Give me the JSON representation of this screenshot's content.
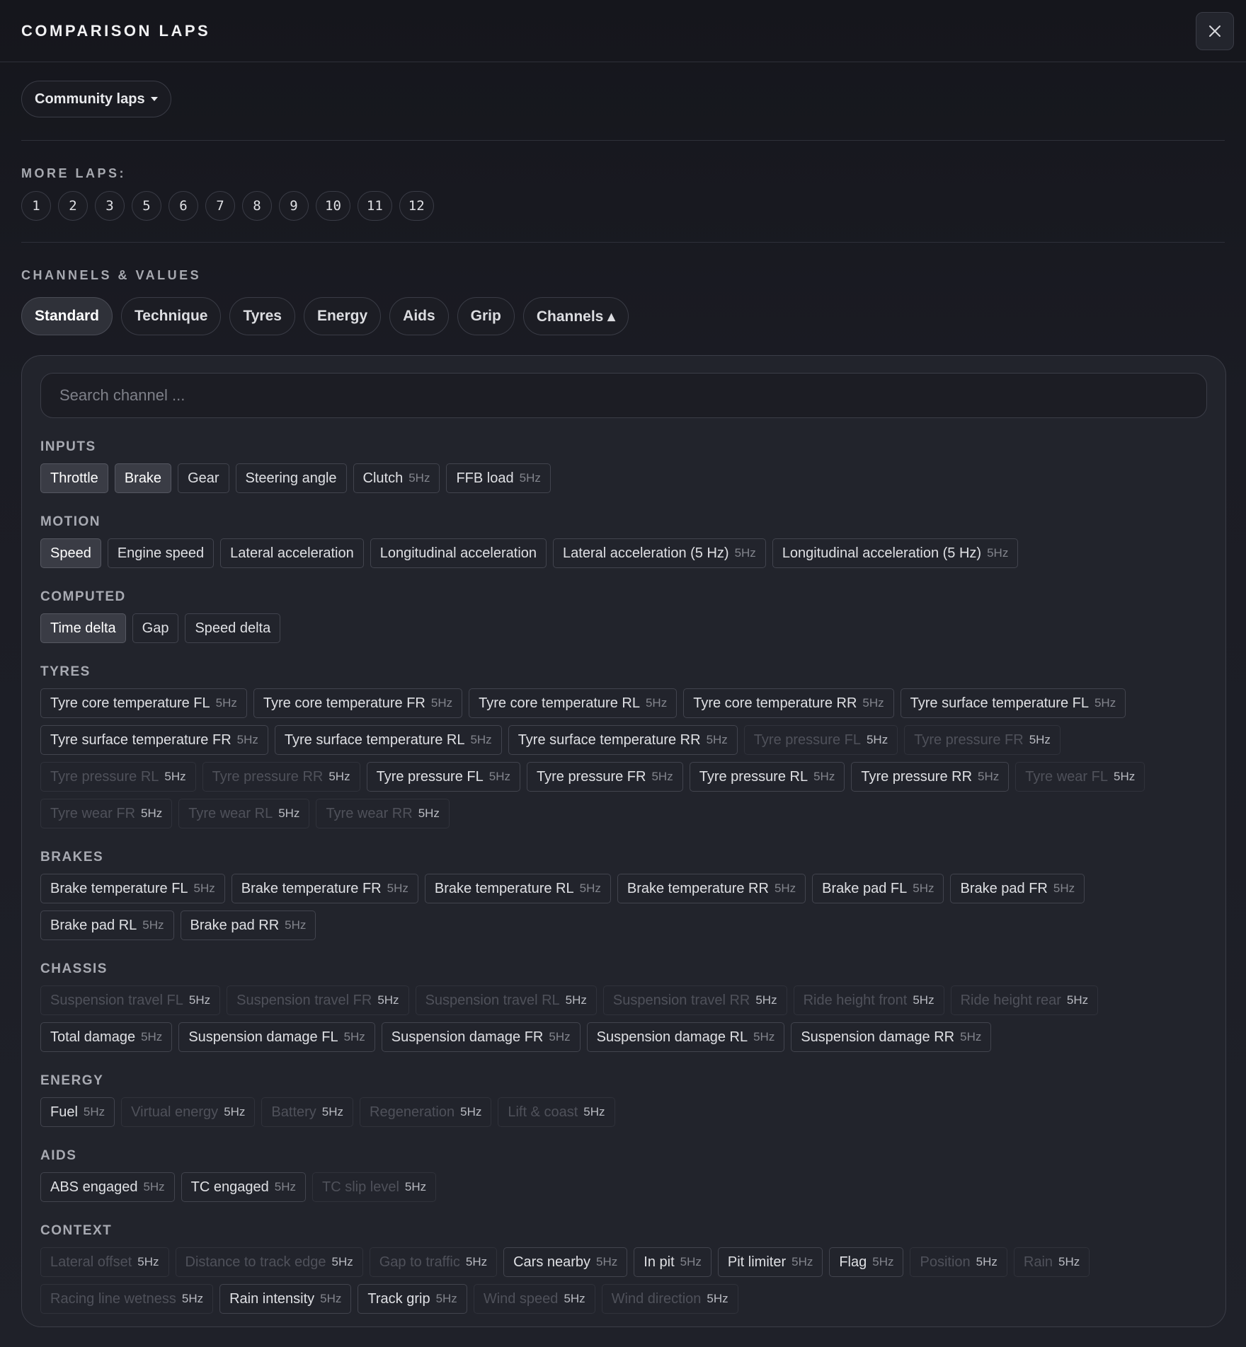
{
  "header": {
    "title": "COMPARISON LAPS",
    "close_label": "✕"
  },
  "source_dropdown": {
    "label": "Community laps"
  },
  "more_laps": {
    "title": "MORE LAPS:",
    "laps": [
      "1",
      "2",
      "3",
      "5",
      "6",
      "7",
      "8",
      "9",
      "10",
      "11",
      "12"
    ]
  },
  "channels": {
    "title": "CHANNELS & VALUES",
    "tabs": [
      {
        "label": "Standard",
        "active": true
      },
      {
        "label": "Technique",
        "active": false
      },
      {
        "label": "Tyres",
        "active": false
      },
      {
        "label": "Energy",
        "active": false
      },
      {
        "label": "Aids",
        "active": false
      },
      {
        "label": "Grip",
        "active": false
      },
      {
        "label": "Channels ▴",
        "active": false
      }
    ],
    "search_placeholder": "Search channel ...",
    "groups": [
      {
        "title": "INPUTS",
        "chips": [
          {
            "label": "Throttle",
            "state": "sel"
          },
          {
            "label": "Brake",
            "state": "sel"
          },
          {
            "label": "Gear"
          },
          {
            "label": "Steering angle"
          },
          {
            "label": "Clutch",
            "hz": "5Hz"
          },
          {
            "label": "FFB load",
            "hz": "5Hz"
          }
        ]
      },
      {
        "title": "MOTION",
        "chips": [
          {
            "label": "Speed",
            "state": "sel"
          },
          {
            "label": "Engine speed"
          },
          {
            "label": "Lateral acceleration"
          },
          {
            "label": "Longitudinal acceleration"
          },
          {
            "label": "Lateral acceleration (5 Hz)",
            "hz": "5Hz"
          },
          {
            "label": "Longitudinal acceleration (5 Hz)",
            "hz": "5Hz"
          }
        ]
      },
      {
        "title": "COMPUTED",
        "chips": [
          {
            "label": "Time delta",
            "state": "sel"
          },
          {
            "label": "Gap"
          },
          {
            "label": "Speed delta"
          }
        ]
      },
      {
        "title": "TYRES",
        "chips": [
          {
            "label": "Tyre core temperature FL",
            "hz": "5Hz"
          },
          {
            "label": "Tyre core temperature FR",
            "hz": "5Hz"
          },
          {
            "label": "Tyre core temperature RL",
            "hz": "5Hz"
          },
          {
            "label": "Tyre core temperature RR",
            "hz": "5Hz"
          },
          {
            "label": "Tyre surface temperature FL",
            "hz": "5Hz"
          },
          {
            "label": "Tyre surface temperature FR",
            "hz": "5Hz"
          },
          {
            "label": "Tyre surface temperature RL",
            "hz": "5Hz"
          },
          {
            "label": "Tyre surface temperature RR",
            "hz": "5Hz"
          },
          {
            "label": "Tyre pressure FL",
            "hz": "5Hz",
            "state": "dim"
          },
          {
            "label": "Tyre pressure FR",
            "hz": "5Hz",
            "state": "dim"
          },
          {
            "label": "Tyre pressure RL",
            "hz": "5Hz",
            "state": "dim"
          },
          {
            "label": "Tyre pressure RR",
            "hz": "5Hz",
            "state": "dim"
          },
          {
            "label": "Tyre pressure FL",
            "hz": "5Hz"
          },
          {
            "label": "Tyre pressure FR",
            "hz": "5Hz"
          },
          {
            "label": "Tyre pressure RL",
            "hz": "5Hz"
          },
          {
            "label": "Tyre pressure RR",
            "hz": "5Hz"
          },
          {
            "label": "Tyre wear FL",
            "hz": "5Hz",
            "state": "dim"
          },
          {
            "label": "Tyre wear FR",
            "hz": "5Hz",
            "state": "dim"
          },
          {
            "label": "Tyre wear RL",
            "hz": "5Hz",
            "state": "dim"
          },
          {
            "label": "Tyre wear RR",
            "hz": "5Hz",
            "state": "dim"
          }
        ]
      },
      {
        "title": "BRAKES",
        "chips": [
          {
            "label": "Brake temperature FL",
            "hz": "5Hz"
          },
          {
            "label": "Brake temperature FR",
            "hz": "5Hz"
          },
          {
            "label": "Brake temperature RL",
            "hz": "5Hz"
          },
          {
            "label": "Brake temperature RR",
            "hz": "5Hz"
          },
          {
            "label": "Brake pad FL",
            "hz": "5Hz"
          },
          {
            "label": "Brake pad FR",
            "hz": "5Hz"
          },
          {
            "label": "Brake pad RL",
            "hz": "5Hz"
          },
          {
            "label": "Brake pad RR",
            "hz": "5Hz"
          }
        ]
      },
      {
        "title": "CHASSIS",
        "chips": [
          {
            "label": "Suspension travel FL",
            "hz": "5Hz",
            "state": "dim"
          },
          {
            "label": "Suspension travel FR",
            "hz": "5Hz",
            "state": "dim"
          },
          {
            "label": "Suspension travel RL",
            "hz": "5Hz",
            "state": "dim"
          },
          {
            "label": "Suspension travel RR",
            "hz": "5Hz",
            "state": "dim"
          },
          {
            "label": "Ride height front",
            "hz": "5Hz",
            "state": "dim"
          },
          {
            "label": "Ride height rear",
            "hz": "5Hz",
            "state": "dim"
          },
          {
            "label": "Total damage",
            "hz": "5Hz"
          },
          {
            "label": "Suspension damage FL",
            "hz": "5Hz"
          },
          {
            "label": "Suspension damage FR",
            "hz": "5Hz"
          },
          {
            "label": "Suspension damage RL",
            "hz": "5Hz"
          },
          {
            "label": "Suspension damage RR",
            "hz": "5Hz"
          }
        ]
      },
      {
        "title": "ENERGY",
        "chips": [
          {
            "label": "Fuel",
            "hz": "5Hz"
          },
          {
            "label": "Virtual energy",
            "hz": "5Hz",
            "state": "dim"
          },
          {
            "label": "Battery",
            "hz": "5Hz",
            "state": "dim"
          },
          {
            "label": "Regeneration",
            "hz": "5Hz",
            "state": "dim"
          },
          {
            "label": "Lift & coast",
            "hz": "5Hz",
            "state": "dim"
          }
        ]
      },
      {
        "title": "AIDS",
        "chips": [
          {
            "label": "ABS engaged",
            "hz": "5Hz"
          },
          {
            "label": "TC engaged",
            "hz": "5Hz"
          },
          {
            "label": "TC slip level",
            "hz": "5Hz",
            "state": "dim"
          }
        ]
      },
      {
        "title": "CONTEXT",
        "chips": [
          {
            "label": "Lateral offset",
            "hz": "5Hz",
            "state": "dim"
          },
          {
            "label": "Distance to track edge",
            "hz": "5Hz",
            "state": "dim"
          },
          {
            "label": "Gap to traffic",
            "hz": "5Hz",
            "state": "dim"
          },
          {
            "label": "Cars nearby",
            "hz": "5Hz"
          },
          {
            "label": "In pit",
            "hz": "5Hz"
          },
          {
            "label": "Pit limiter",
            "hz": "5Hz"
          },
          {
            "label": "Flag",
            "hz": "5Hz"
          },
          {
            "label": "Position",
            "hz": "5Hz",
            "state": "dim"
          },
          {
            "label": "Rain",
            "hz": "5Hz",
            "state": "dim"
          },
          {
            "label": "Racing line wetness",
            "hz": "5Hz",
            "state": "dim"
          },
          {
            "label": "Rain intensity",
            "hz": "5Hz"
          },
          {
            "label": "Track grip",
            "hz": "5Hz"
          },
          {
            "label": "Wind speed",
            "hz": "5Hz",
            "state": "dim"
          },
          {
            "label": "Wind direction",
            "hz": "5Hz",
            "state": "dim"
          }
        ]
      }
    ]
  }
}
